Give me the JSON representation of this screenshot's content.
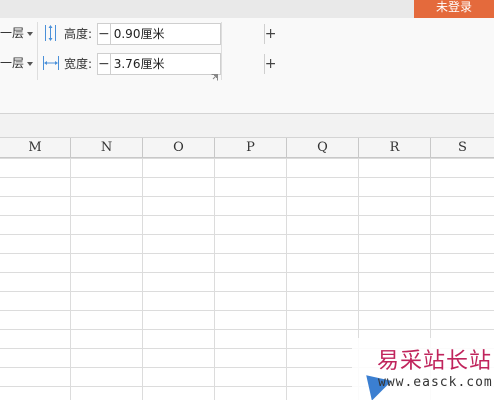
{
  "header": {
    "login_label": "未登录"
  },
  "ribbon": {
    "layer_up_label": "一层",
    "layer_down_label": "一层",
    "height": {
      "label": "高度:",
      "value": "0.90厘米",
      "minus": "−",
      "plus": "+"
    },
    "width": {
      "label": "宽度:",
      "value": "3.76厘米",
      "minus": "−",
      "plus": "+"
    }
  },
  "sheet": {
    "columns": [
      "M",
      "N",
      "O",
      "P",
      "Q",
      "R",
      "S"
    ]
  },
  "watermark": {
    "title": "易采站长站",
    "url": "www.easck.com"
  },
  "colors": {
    "accent": "#e46a3c",
    "watermark": "#c0245c",
    "grid": "#dcdcdc"
  }
}
